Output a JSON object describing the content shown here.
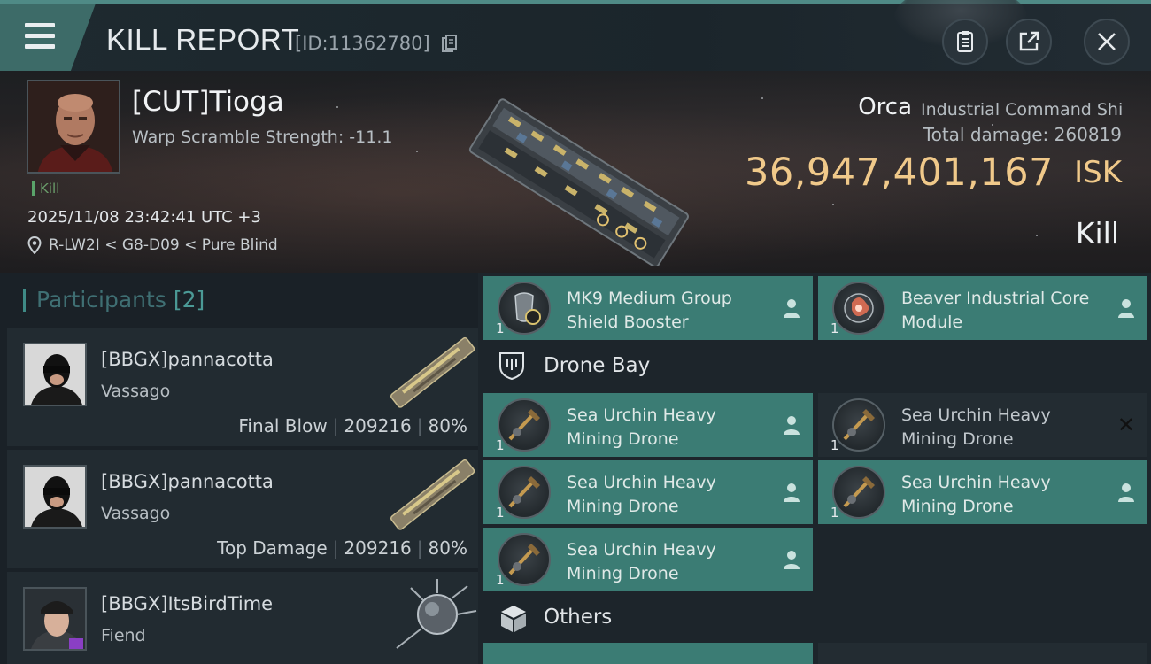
{
  "header": {
    "title": "KILL REPORT",
    "report_id": "[ID:11362780]"
  },
  "victim": {
    "name": "[CUT]Tioga",
    "warp_scramble": "Warp Scramble Strength: -11.1",
    "kill_tag": "Kill",
    "datetime": "2025/11/08 23:42:41 UTC +3",
    "location": "R-LW2I < G8-D09 < Pure Blind",
    "ship_name": "Orca",
    "ship_class": "Industrial Command Shi",
    "total_damage_label": "Total damage:",
    "total_damage": "260819",
    "isk_value": "36,947,401,167",
    "isk_unit": "ISK",
    "result": "Kill"
  },
  "participants": {
    "label": "Participants",
    "count": "[2]",
    "items": [
      {
        "name": "[BBGX]pannacotta",
        "ship": "Vassago",
        "role": "Final Blow",
        "damage": "209216",
        "percent": "80%"
      },
      {
        "name": "[BBGX]pannacotta",
        "ship": "Vassago",
        "role": "Top Damage",
        "damage": "209216",
        "percent": "80%"
      },
      {
        "name": "[BBGX]ItsBirdTime",
        "ship": "Fiend"
      }
    ]
  },
  "modules": [
    {
      "name": "MK9 Medium Group Shield Booster",
      "qty": "1"
    },
    {
      "name": "Beaver Industrial Core Module",
      "qty": "1"
    }
  ],
  "drone_bay": {
    "title": "Drone Bay",
    "items": [
      {
        "name": "Sea Urchin Heavy Mining Drone",
        "qty": "1",
        "state": "dropped"
      },
      {
        "name": "Sea Urchin Heavy Mining Drone",
        "qty": "1",
        "state": "destroyed"
      },
      {
        "name": "Sea Urchin Heavy Mining Drone",
        "qty": "1",
        "state": "dropped"
      },
      {
        "name": "Sea Urchin Heavy Mining Drone",
        "qty": "1",
        "state": "dropped"
      },
      {
        "name": "Sea Urchin Heavy Mining Drone",
        "qty": "1",
        "state": "dropped"
      }
    ]
  },
  "others": {
    "title": "Others"
  },
  "colors": {
    "accent_teal": "#3b7c74",
    "isk_gold": "#f0c98a",
    "header_tab": "#3d6b68"
  },
  "icons": {
    "menu": "menu-icon",
    "copy": "copy-icon",
    "clipboard": "clipboard-icon",
    "share": "share-icon",
    "close": "close-icon",
    "location": "location-pin-icon",
    "person": "person-icon",
    "drone_bay": "shield-drone-icon",
    "others": "cube-icon"
  }
}
